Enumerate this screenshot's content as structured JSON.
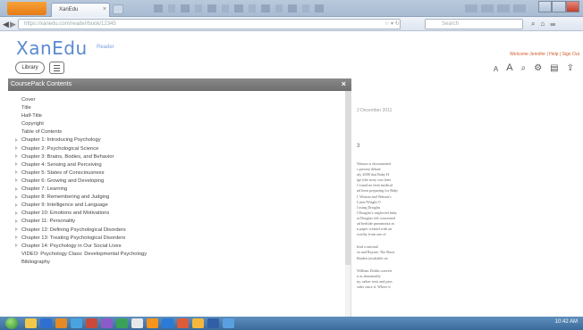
{
  "browser": {
    "tab_title": "XanEdu",
    "url": "https://xanedu.com/reader/book/12345",
    "search_placeholder": "Search"
  },
  "header": {
    "logo": "XanEdu",
    "logo_sub": "Reader",
    "links": "Welcome Jennifer | Help | Sign Out"
  },
  "toolbar": {
    "library_label": "Library",
    "font_small": "A",
    "font_large": "A"
  },
  "toc": {
    "title": "CoursePack Contents",
    "close_symbol": "×",
    "items": [
      {
        "label": "Cover",
        "chapter": false
      },
      {
        "label": "Title",
        "chapter": false
      },
      {
        "label": "Half-Title",
        "chapter": false
      },
      {
        "label": "Copyright",
        "chapter": false
      },
      {
        "label": "Table of Contents",
        "chapter": false
      },
      {
        "label": "Chapter 1: Introducing Psychology",
        "chapter": true
      },
      {
        "label": "Chapter 2: Psychological Science",
        "chapter": true
      },
      {
        "label": "Chapter 3: Brains, Bodies, and Behavior",
        "chapter": true
      },
      {
        "label": "Chapter 4: Sensing and Perceiving",
        "chapter": true
      },
      {
        "label": "Chapter 5: States of Consciousness",
        "chapter": true
      },
      {
        "label": "Chapter 6: Growing and Developing",
        "chapter": true
      },
      {
        "label": "Chapter 7: Learning",
        "chapter": true
      },
      {
        "label": "Chapter 8: Remembering and Judging",
        "chapter": true
      },
      {
        "label": "Chapter 9: Intelligence and Language",
        "chapter": true
      },
      {
        "label": "Chapter 10: Emotions and Motivations",
        "chapter": true
      },
      {
        "label": "Chapter 11: Personality",
        "chapter": true
      },
      {
        "label": "Chapter 12: Defining Psychological Disorders",
        "chapter": true
      },
      {
        "label": "Chapter 13: Treating Psychological Disorders",
        "chapter": true
      },
      {
        "label": "Chapter 14: Psychology in Our Social Lives",
        "chapter": true
      },
      {
        "label": "VIDEO: Psychology Class: Developmental Psychology",
        "chapter": false
      },
      {
        "label": "Bibliography",
        "chapter": false
      }
    ]
  },
  "page": {
    "date": "2 December 2011",
    "heading": "3",
    "lines": [
      "Watson is documented",
      "s present debate",
      "uly 2008 that Baby H",
      "ige (the story was later",
      "l found no fetal medical",
      "nd been preparing for Baby",
      "l. Watson and Watson's",
      "Lister/Wright O",
      "l using Douglas",
      "l Douglas's neglected baby",
      "at Douglas felt concerned",
      "ad bedside pneumonia in",
      "n paper created with an",
      "worthy from one of",
      "",
      "lead a rational",
      "ea and Rayner. The Basic",
      "Baiden (available on",
      "",
      "William Dobbs convert",
      "n as abnormally",
      "ny, rather tests and pass",
      "sider since it. Where it"
    ]
  },
  "taskbar": {
    "time": "10:42 AM"
  }
}
